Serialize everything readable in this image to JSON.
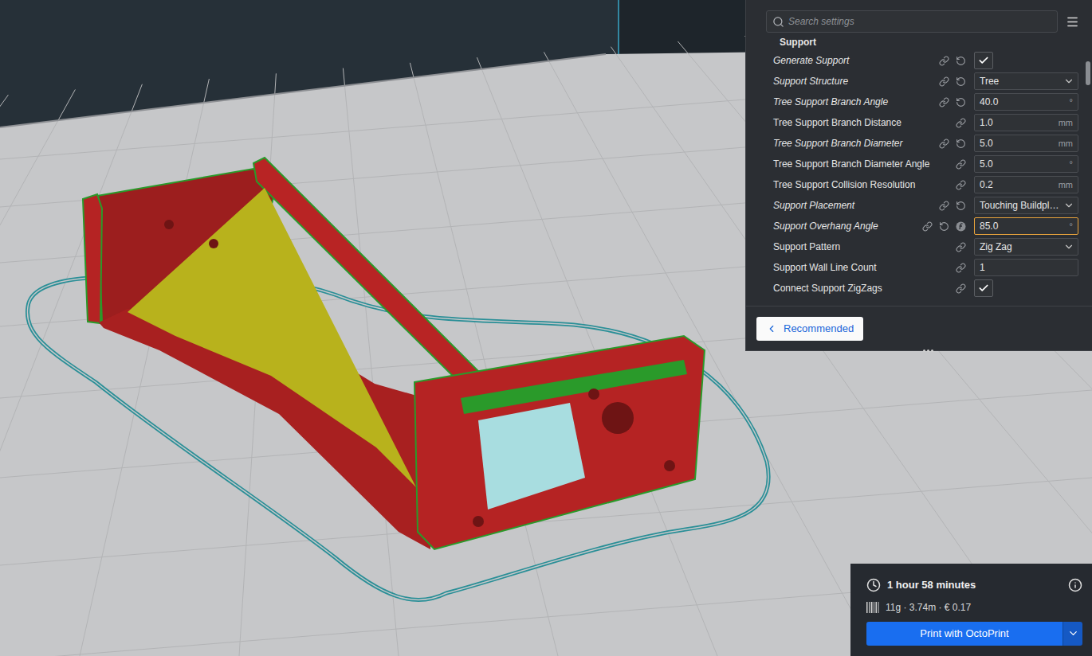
{
  "settings_panel": {
    "search": {
      "placeholder": "Search settings"
    },
    "section": "Support",
    "settings": [
      {
        "label": "Generate Support",
        "kind": "checkbox",
        "checked": true,
        "value": "",
        "unit": "",
        "modified": true,
        "focused": false,
        "formula": false
      },
      {
        "label": "Support Structure",
        "kind": "dropdown",
        "checked": false,
        "value": "Tree",
        "unit": "",
        "modified": true,
        "focused": false,
        "formula": false
      },
      {
        "label": "Tree Support Branch Angle",
        "kind": "number",
        "checked": false,
        "value": "40.0",
        "unit": "°",
        "modified": true,
        "focused": false,
        "formula": false
      },
      {
        "label": "Tree Support Branch Distance",
        "kind": "number",
        "checked": false,
        "value": "1.0",
        "unit": "mm",
        "modified": false,
        "focused": false,
        "formula": false
      },
      {
        "label": "Tree Support Branch Diameter",
        "kind": "number",
        "checked": false,
        "value": "5.0",
        "unit": "mm",
        "modified": true,
        "focused": false,
        "formula": false
      },
      {
        "label": "Tree Support Branch Diameter Angle",
        "kind": "number",
        "checked": false,
        "value": "5.0",
        "unit": "°",
        "modified": false,
        "focused": false,
        "formula": false
      },
      {
        "label": "Tree Support Collision Resolution",
        "kind": "number",
        "checked": false,
        "value": "0.2",
        "unit": "mm",
        "modified": false,
        "focused": false,
        "formula": false
      },
      {
        "label": "Support Placement",
        "kind": "dropdown",
        "checked": false,
        "value": "Touching Buildpl…",
        "unit": "",
        "modified": true,
        "focused": false,
        "formula": false
      },
      {
        "label": "Support Overhang Angle",
        "kind": "number",
        "checked": false,
        "value": "85.0",
        "unit": "°",
        "modified": true,
        "focused": true,
        "formula": true
      },
      {
        "label": "Support Pattern",
        "kind": "dropdown",
        "checked": false,
        "value": "Zig Zag",
        "unit": "",
        "modified": false,
        "focused": false,
        "formula": false
      },
      {
        "label": "Support Wall Line Count",
        "kind": "number",
        "checked": false,
        "value": "1",
        "unit": "",
        "modified": false,
        "focused": false,
        "formula": false
      },
      {
        "label": "Connect Support ZigZags",
        "kind": "checkbox",
        "checked": true,
        "value": "",
        "unit": "",
        "modified": false,
        "focused": false,
        "formula": false
      }
    ],
    "recommended_button": "Recommended"
  },
  "print_panel": {
    "time": "1 hour 58 minutes",
    "material": "11g · 3.74m · € 0.17",
    "button": "Print with OctoPrint"
  }
}
